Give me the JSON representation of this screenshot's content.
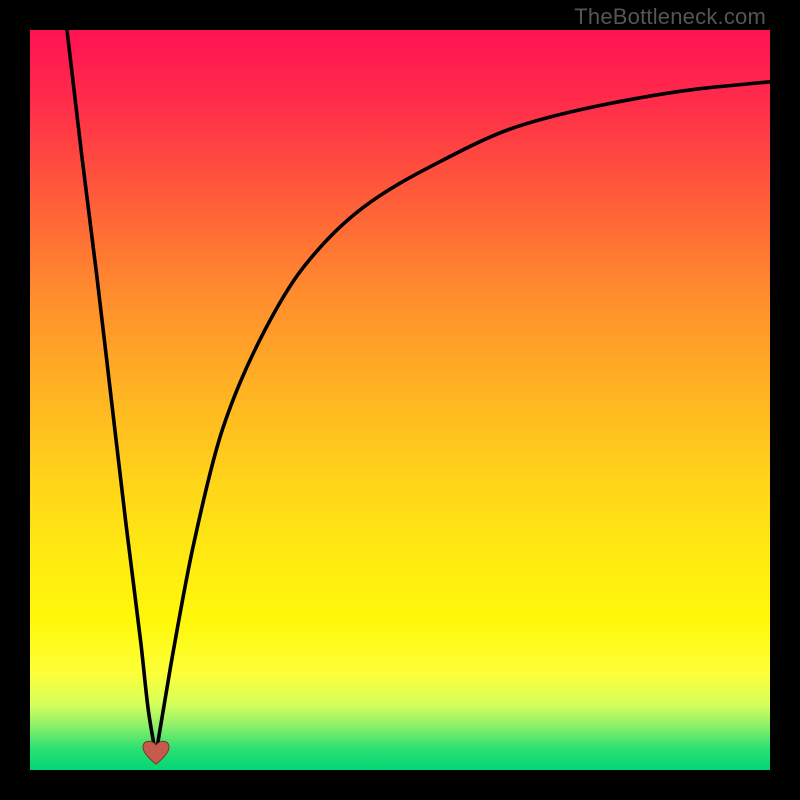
{
  "watermark": "TheBottleneck.com",
  "colors": {
    "frame": "#000000",
    "curve": "#000000",
    "heart": "#c65a4d",
    "gradient_top": "#ff1253",
    "gradient_bottom": "#00d775"
  },
  "chart_data": {
    "type": "line",
    "title": "",
    "xlabel": "",
    "ylabel": "",
    "xlim": [
      0,
      100
    ],
    "ylim": [
      0,
      100
    ],
    "axes_visible": false,
    "grid": false,
    "annotations": [
      {
        "name": "heart-marker",
        "x": 17,
        "y": 2
      }
    ],
    "series": [
      {
        "name": "left-branch",
        "x": [
          5,
          7,
          9,
          11,
          13,
          15,
          16,
          17
        ],
        "values": [
          100,
          83,
          67,
          50,
          33,
          17,
          8,
          2
        ]
      },
      {
        "name": "right-branch",
        "x": [
          17,
          19,
          22,
          26,
          31,
          37,
          45,
          55,
          66,
          78,
          90,
          100
        ],
        "values": [
          2,
          14,
          30,
          46,
          58,
          68,
          76,
          82,
          87,
          90,
          92,
          93
        ]
      }
    ],
    "notes": "x and y are in 0–100 plot-fraction units (no visible tick labels); y increases upward. The visible curve is two smooth monotone branches meeting at a cusp near (17, 2) where a small heart marker sits."
  }
}
